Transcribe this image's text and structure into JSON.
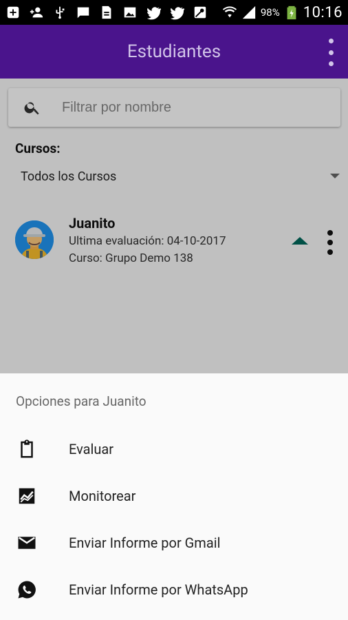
{
  "status_bar": {
    "battery_percent": "98%",
    "time": "10:16"
  },
  "app_bar": {
    "title": "Estudiantes"
  },
  "search": {
    "placeholder": "Filtrar por nombre",
    "value": ""
  },
  "filter": {
    "label": "Cursos:",
    "selected": "Todos los Cursos"
  },
  "students": [
    {
      "name": "Juanito",
      "last_evaluation": "Ultima evaluación: 04-10-2017",
      "course": "Curso: Grupo Demo 138",
      "trend": "up",
      "trend_color": "#00695c"
    }
  ],
  "sheet": {
    "title": "Opciones para Juanito",
    "options": [
      {
        "label": "Evaluar",
        "icon": "clipboard-icon"
      },
      {
        "label": "Monitorear",
        "icon": "chart-icon"
      },
      {
        "label": "Enviar Informe por Gmail",
        "icon": "email-icon"
      },
      {
        "label": "Enviar Informe por WhatsApp",
        "icon": "whatsapp-icon"
      }
    ]
  },
  "colors": {
    "primary": "#4a148c",
    "title_text": "#d1c4e9",
    "trend": "#00695c"
  }
}
